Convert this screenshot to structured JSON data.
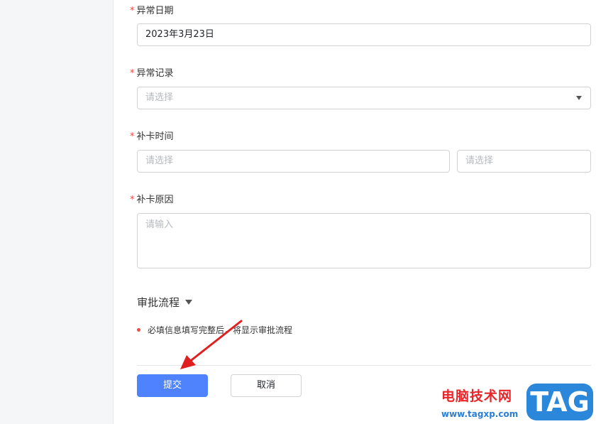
{
  "form": {
    "date": {
      "label": "异常日期",
      "value": "2023年3月23日"
    },
    "record": {
      "label": "异常记录",
      "placeholder": "请选择"
    },
    "time": {
      "label": "补卡时间",
      "placeholder_start": "请选择",
      "placeholder_end": "请选择"
    },
    "reason": {
      "label": "补卡原因",
      "placeholder": "请输入"
    },
    "required_mark": "*"
  },
  "approval": {
    "title": "审批流程",
    "hint": "必填信息填写完整后，将显示审批流程"
  },
  "buttons": {
    "submit": "提交",
    "cancel": "取消"
  },
  "watermark": {
    "site_name": "电脑技术网",
    "url": "www.tagxp.com",
    "logo": "TAG"
  },
  "colors": {
    "primary": "#4e83fd",
    "required": "#f54a45",
    "annotation_arrow": "#e02020"
  }
}
